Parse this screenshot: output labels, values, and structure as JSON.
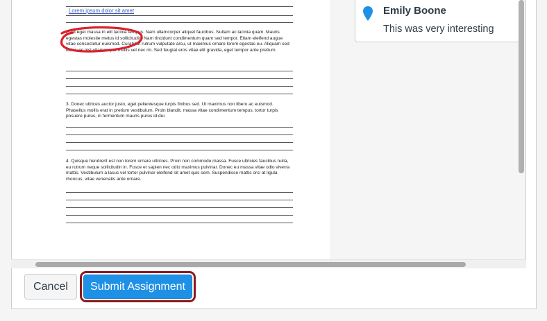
{
  "document": {
    "header_link": "Lorem ipsum dolor sit amet",
    "paragraphs": [
      {
        "text": "2. Ut eget massa in elit lacinia tempus. Nam ullamcorper aliquet faucibus. Nullam ac lacinia quam. Mauris egestas molestie metus id sollicitudin. Nam tincidunt condimentum quam sed tempor. Etiam eleifend augue vitae consectetur euismod. Curabitur rutrum vulputate arcu, ut maximus ornare lorem egestas eu. Aliquam sed dolor vel nisl ullamcorper mollis vel nec mi. Sed feugiat eros vitae elit gravida, eget tempor ante pretium."
      },
      {
        "text": "3. Donec ultrices auctor justo, eget pellentesque turpis finibus sed. Ut maximus non libero ac euismod. Phasellus mollis erat in pretium vestibulum. Proin blandit, massa vitae condimentum tempus, tortor turpis posuere purus, in fermentum mauris purus id dui."
      },
      {
        "text": "4. Quisque hendrerit est non lorem ornare ultricies. Proin non commodo massa. Fusce ultricies faucibus nulla, eu rutrum neque sollicitudin in. Fusce et sapien nec odio maximus pulvinar. Donec eu massa vitae odio viverra mattis. Vestibulum a lacus vel tortor pulvinar eleifend sit amet quis sem. Suspendisse mattis orci at ligula rhoncus, vitae venenatis ante ornare."
      }
    ]
  },
  "comment": {
    "author": "Emily Boone",
    "text": "This was very interesting",
    "icon": "map-pin-icon",
    "pin_color": "#1e90e6"
  },
  "annotation": {
    "color": "#d9232e",
    "shape": "freehand-circle"
  },
  "actions": {
    "cancel_label": "Cancel",
    "submit_label": "Submit Assignment",
    "submit_color": "#1e90e6",
    "highlight_color": "#8b1a1a"
  }
}
